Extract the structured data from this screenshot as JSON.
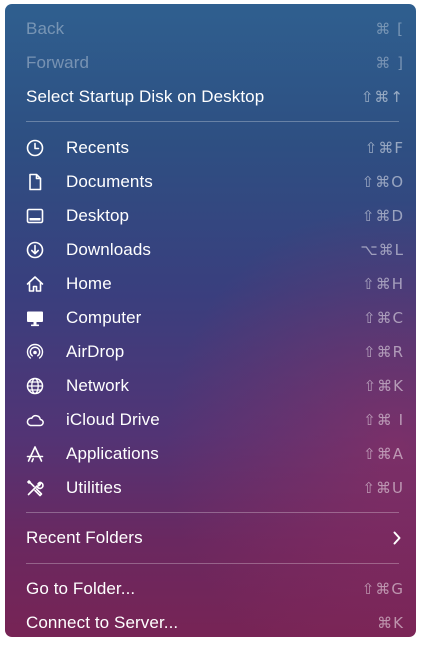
{
  "menu": {
    "nav": [
      {
        "label": "Back",
        "shortcut": "⌘ [",
        "enabled": false
      },
      {
        "label": "Forward",
        "shortcut": "⌘ ]",
        "enabled": false
      },
      {
        "label": "Select Startup Disk on Desktop",
        "shortcut": "⇧⌘↑",
        "enabled": true
      }
    ],
    "locations": [
      {
        "label": "Recents",
        "shortcut": "⇧⌘F",
        "icon": "clock-icon"
      },
      {
        "label": "Documents",
        "shortcut": "⇧⌘O",
        "icon": "document-icon"
      },
      {
        "label": "Desktop",
        "shortcut": "⇧⌘D",
        "icon": "desktop-icon"
      },
      {
        "label": "Downloads",
        "shortcut": "⌥⌘L",
        "icon": "download-icon"
      },
      {
        "label": "Home",
        "shortcut": "⇧⌘H",
        "icon": "house-icon"
      },
      {
        "label": "Computer",
        "shortcut": "⇧⌘C",
        "icon": "computer-icon"
      },
      {
        "label": "AirDrop",
        "shortcut": "⇧⌘R",
        "icon": "airdrop-icon"
      },
      {
        "label": "Network",
        "shortcut": "⇧⌘K",
        "icon": "globe-icon"
      },
      {
        "label": "iCloud Drive",
        "shortcut": "⇧⌘ I",
        "icon": "cloud-icon"
      },
      {
        "label": "Applications",
        "shortcut": "⇧⌘A",
        "icon": "applications-icon"
      },
      {
        "label": "Utilities",
        "shortcut": "⇧⌘U",
        "icon": "tools-icon"
      }
    ],
    "recent_folders": {
      "label": "Recent Folders",
      "icon": "chevron-right-icon"
    },
    "go": [
      {
        "label": "Go to Folder...",
        "shortcut": "⇧⌘G"
      },
      {
        "label": "Connect to Server...",
        "shortcut": "⌘K"
      }
    ]
  }
}
